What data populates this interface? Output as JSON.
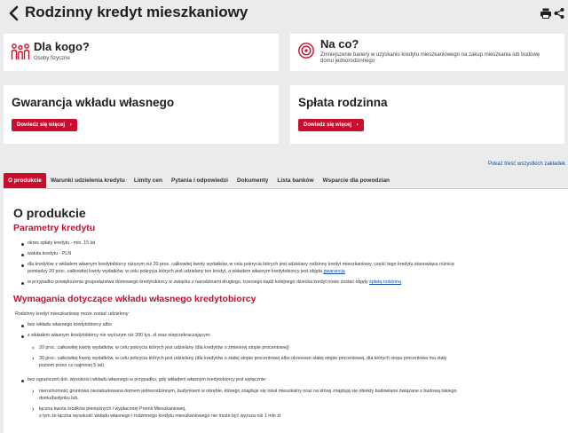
{
  "header": {
    "title": "Rodzinny kredyt mieszkaniowy"
  },
  "cards": {
    "for_whom": {
      "title": "Dla kogo?",
      "subtitle": "Osoby fizyczne"
    },
    "purpose": {
      "title": "Na co?",
      "subtitle_line1": "Zmniejszenie bariery w uzyskaniu kredytu mieszkaniowego na zakup mieszkania lub budowę",
      "subtitle_line2": "domu jednorodzinnego"
    },
    "guarantee": {
      "title": "Gwarancja wkładu własnego",
      "button": "Dowiedz się więcej"
    },
    "repayment": {
      "title": "Spłata rodzinna",
      "button": "Dowiedz się więcej"
    }
  },
  "show_all": "Pokaż treść wszystkich zakładek",
  "tabs": [
    {
      "label": "O produkcie",
      "active": true
    },
    {
      "label": "Warunki udzielenia kredytu"
    },
    {
      "label": "Limity cen"
    },
    {
      "label": "Pytania i odpowiedzi"
    },
    {
      "label": "Dokumenty"
    },
    {
      "label": "Lista banków"
    },
    {
      "label": "Wsparcie dla powodzian"
    }
  ],
  "content": {
    "heading": "O produkcie",
    "params_heading": "Parametry kredytu",
    "params": [
      "okres spłaty kredytu - min. 15 lat",
      "waluta kredytu - PLN",
      "dla kredytów z wkładem własnym kredytobiorcy niższym niż 20 proc. całkowitej kwoty wydatków, w celu pokrycia których jest udzielany rodzinny kredyt mieszkaniowy, część tego kredytu stanowiąca różnicę",
      "pomiędzy 20 proc. całkowitej kwoty wydatków, w celu pokrycia których jest udzielany ten kredyt, a wkładem własnym kredytobiorcy jest objęta",
      "gwarancją",
      "w przypadku powiększenia gospodarstwa domowego kredytobiorcy w związku z narodzinami drugiego, trzeciego bądź kolejnego dziecka kredyt może zostać objęty",
      "spłatą rodzinną"
    ],
    "req_heading": "Wymagania dotyczące wkładu własnego kredytobiorcy",
    "req_intro": "Rodzinny kredyt mieszkaniowy może zostać udzielony:",
    "req_items": [
      "bez wkładu własnego kredytobiorcy albo",
      "z wkładem własnym kredytobiorcy nie wyższym niż 200 tys. zł oraz nieprzekraczającym:"
    ],
    "req_sub1": [
      "20 proc. całkowitej kwoty wydatków, w celu pokrycia których jest udzielany (dla kredytów o zmiennej stopie procentowej)",
      "30 proc. całkowitej kwoty wydatków, w celu pokrycia których jest udzielany (dla kredytów o stałej stopie procentowej albo okresowo stałej stopie procentowej, dla których stopa procentowa ma stały",
      "poziom przez co najmniej 5 lat)"
    ],
    "req_item3": "bez ograniczeń dot. wysokości wkładu własnego w przypadku, gdy wkładem własnym kredytobiorcy jest wyłącznie:",
    "req_sub2": [
      "nieruchomość gruntowa niezabudowana domem jednorodzinnym, budynkiem w obrębie, którego znajduje się lokal mieszkalny oraz na której znajdują się obiekty budowlane związane z budową takiego",
      "domu/budynku lub,",
      "łączna kwota środków pieniężnych i wypłaconej Premii Mieszkaniowej,",
      "z tym że łączna wysokość wkładu własnego i rodzinnego kredytu mieszkaniowego nie może być wyższa niż 1 mln zł"
    ]
  },
  "colors": {
    "accent": "#c8102e",
    "link": "#0c4fa8",
    "background": "#ebebeb"
  }
}
